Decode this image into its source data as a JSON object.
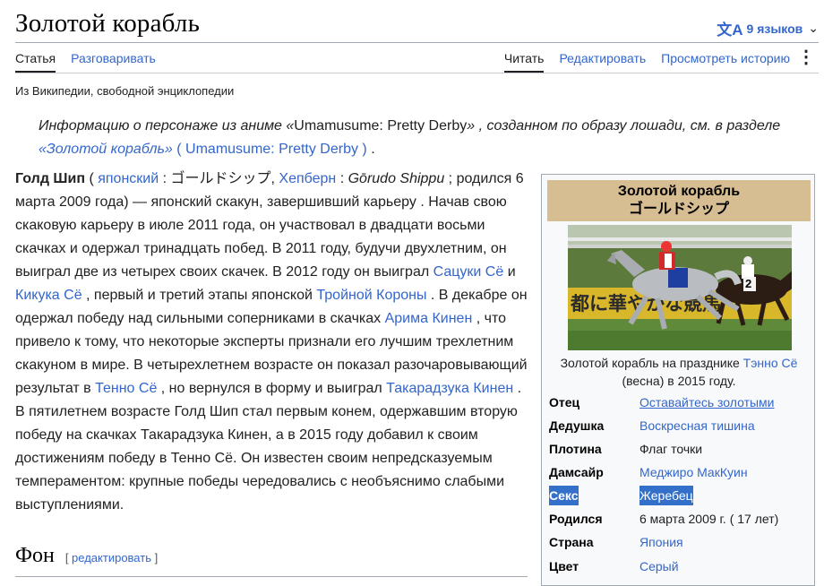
{
  "page": {
    "title": "Золотой корабль",
    "languages": "9 языков",
    "tabs_left": [
      "Статья",
      "Разговаривать"
    ],
    "tabs_right": [
      "Читать",
      "Редактировать",
      "Просмотреть историю"
    ],
    "tagline": "Из Википедии, свободной энциклопедии"
  },
  "hatnote": {
    "p1": "Информацию о персонаже из аниме «",
    "anime": "Umamusume: Pretty Derby",
    "p2": "» , созданном по образу лошади, см. в разделе ",
    "link1": "«Золотой корабль»",
    "link2": "( Umamusume: Pretty Derby )",
    "end": " ."
  },
  "lead": {
    "name": "Голд Шип",
    "t1": " ( ",
    "l_japanese": "японский",
    "t2": " : ゴールドシップ, ",
    "l_hepburn": "Хепберн",
    "t3": " : ",
    "romaji": "Gōrudo Shippu",
    "t4": " ; родился 6 марта 2009 года) — японский скакун, завершивший карьеру . Начав свою скаковую карьеру в июле 2011 года, он участвовал в двадцати восьми скачках и одержал тринадцать побед. В 2011 году, будучи двухлетним, он выиграл две из четырех своих скачек. В 2012 году он выиграл ",
    "l_satsuki": "Сацуки Сё",
    "t5": " и ",
    "l_kikuka": "Кикука Сё",
    "t6": " , первый и третий этапы японской ",
    "l_triple": "Тройной Короны",
    "t7": " . В декабре он одержал победу над сильными соперниками в скачках ",
    "l_arima": "Арима Кинен",
    "t8": " , что привело к тому, что некоторые эксперты признали его лучшим трехлетним скакуном в мире. В четырехлетнем возрасте он показал разочаровывающий результат в ",
    "l_tenno": "Тенно Сё",
    "t9": " , но вернулся в форму и выиграл ",
    "l_takara": "Такарадзука Кинен",
    "t10": " . В пятилетнем возрасте Голд Шип стал первым конем, одержавшим вторую победу на скачках Такарадзука Кинен, а в 2015 году добавил к своим достижениям победу в Тенно Сё. Он известен своим непредсказуемым темпераментом: крупные победы чередовались с необъяснимо слабыми выступлениями."
  },
  "section": {
    "heading": "Фон",
    "edit_link": "редактировать"
  },
  "infobox": {
    "title_ru": "Золотой корабль",
    "title_jp": "ゴールドシップ",
    "image_text": "都に華やかな競馬",
    "image_number": "2",
    "caption_1": "Золотой корабль на празднике ",
    "caption_link": "Тэнно Сё",
    "caption_2": "(весна) в 2015 году.",
    "rows": [
      {
        "k": "Отец",
        "v": "Оставайтесь золотыми"
      },
      {
        "k": "Дедушка",
        "v": "Воскресная тишина"
      },
      {
        "k": "Плотина",
        "v": "Флаг точки"
      },
      {
        "k": "Дамсайр",
        "v": "Меджиро МакКуин"
      },
      {
        "k": "Секс",
        "v": "Жеребец"
      },
      {
        "k": "Родился",
        "v": "6 марта 2009 г. (  17 лет)"
      },
      {
        "k": "Страна",
        "v": "Япония"
      },
      {
        "k": "Цвет",
        "v": "Серый"
      }
    ]
  }
}
